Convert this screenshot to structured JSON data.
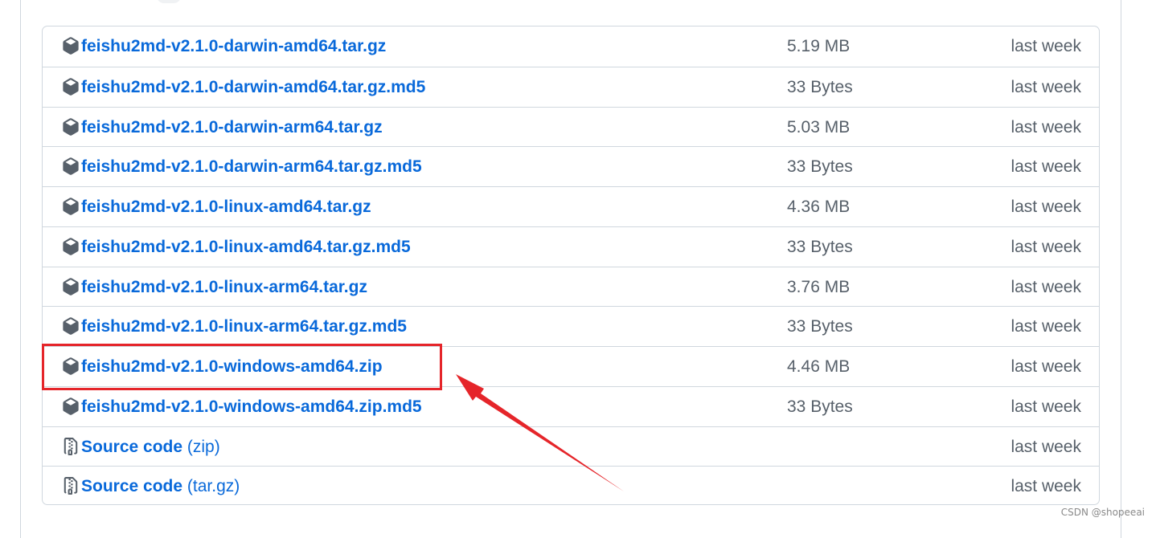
{
  "assets": [
    {
      "name": "feishu2md-v2.1.0-darwin-amd64.tar.gz",
      "size": "5.19 MB",
      "time": "last week",
      "icon": "package-icon"
    },
    {
      "name": "feishu2md-v2.1.0-darwin-amd64.tar.gz.md5",
      "size": "33 Bytes",
      "time": "last week",
      "icon": "package-icon"
    },
    {
      "name": "feishu2md-v2.1.0-darwin-arm64.tar.gz",
      "size": "5.03 MB",
      "time": "last week",
      "icon": "package-icon"
    },
    {
      "name": "feishu2md-v2.1.0-darwin-arm64.tar.gz.md5",
      "size": "33 Bytes",
      "time": "last week",
      "icon": "package-icon"
    },
    {
      "name": "feishu2md-v2.1.0-linux-amd64.tar.gz",
      "size": "4.36 MB",
      "time": "last week",
      "icon": "package-icon"
    },
    {
      "name": "feishu2md-v2.1.0-linux-amd64.tar.gz.md5",
      "size": "33 Bytes",
      "time": "last week",
      "icon": "package-icon"
    },
    {
      "name": "feishu2md-v2.1.0-linux-arm64.tar.gz",
      "size": "3.76 MB",
      "time": "last week",
      "icon": "package-icon"
    },
    {
      "name": "feishu2md-v2.1.0-linux-arm64.tar.gz.md5",
      "size": "33 Bytes",
      "time": "last week",
      "icon": "package-icon"
    },
    {
      "name": "feishu2md-v2.1.0-windows-amd64.zip",
      "size": "4.46 MB",
      "time": "last week",
      "icon": "package-icon",
      "highlighted": true
    },
    {
      "name": "feishu2md-v2.1.0-windows-amd64.zip.md5",
      "size": "33 Bytes",
      "time": "last week",
      "icon": "package-icon"
    },
    {
      "name": "Source code",
      "ext": "(zip)",
      "size": "",
      "time": "last week",
      "icon": "file-zip-icon"
    },
    {
      "name": "Source code",
      "ext": "(tar.gz)",
      "size": "",
      "time": "last week",
      "icon": "file-zip-icon"
    }
  ],
  "annotation": {
    "color": "#e5252a"
  },
  "watermark": "CSDN @shopeeai",
  "colors": {
    "link": "#0969da",
    "muted": "#57606a",
    "border": "#d0d7de"
  }
}
